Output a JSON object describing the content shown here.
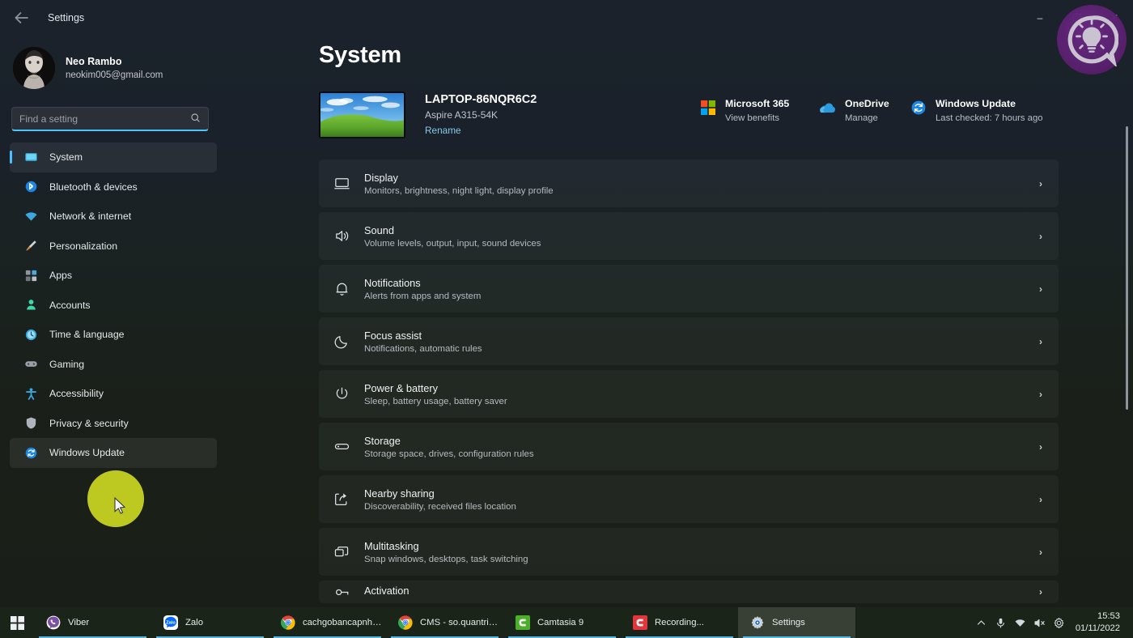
{
  "window": {
    "title": "Settings",
    "back_icon": "back-arrow-icon",
    "minimize": "–",
    "maximize": "❐",
    "close": "✕"
  },
  "profile": {
    "name": "Neo Rambo",
    "email": "neokim005@gmail.com"
  },
  "search": {
    "placeholder": "Find a setting",
    "value": "",
    "icon": "search-icon"
  },
  "sidebar": {
    "items": [
      {
        "label": "System",
        "icon": "monitor-icon",
        "active": true,
        "hovered": false
      },
      {
        "label": "Bluetooth & devices",
        "icon": "bluetooth-icon",
        "active": false,
        "hovered": false
      },
      {
        "label": "Network & internet",
        "icon": "wifi-icon",
        "active": false,
        "hovered": false
      },
      {
        "label": "Personalization",
        "icon": "paintbrush-icon",
        "active": false,
        "hovered": false
      },
      {
        "label": "Apps",
        "icon": "apps-grid-icon",
        "active": false,
        "hovered": false
      },
      {
        "label": "Accounts",
        "icon": "person-icon",
        "active": false,
        "hovered": false
      },
      {
        "label": "Time & language",
        "icon": "clock-globe-icon",
        "active": false,
        "hovered": false
      },
      {
        "label": "Gaming",
        "icon": "gamepad-icon",
        "active": false,
        "hovered": false
      },
      {
        "label": "Accessibility",
        "icon": "accessibility-person-icon",
        "active": false,
        "hovered": false
      },
      {
        "label": "Privacy & security",
        "icon": "shield-icon",
        "active": false,
        "hovered": false
      },
      {
        "label": "Windows Update",
        "icon": "update-refresh-icon",
        "active": false,
        "hovered": true
      }
    ]
  },
  "main": {
    "page_title": "System",
    "device": {
      "name": "LAPTOP-86NQR6C2",
      "model": "Aspire A315-54K",
      "rename_label": "Rename",
      "thumbnail": "bliss-wallpaper-thumbnail"
    },
    "status_tiles": [
      {
        "title": "Microsoft 365",
        "sub": "View benefits",
        "icon": "microsoft-logo-icon"
      },
      {
        "title": "OneDrive",
        "sub": "Manage",
        "icon": "onedrive-cloud-icon"
      },
      {
        "title": "Windows Update",
        "sub": "Last checked: 7 hours ago",
        "icon": "update-refresh-icon"
      }
    ],
    "settings_rows": [
      {
        "title": "Display",
        "sub": "Monitors, brightness, night light, display profile",
        "icon": "display-monitor-icon",
        "chevron": "›"
      },
      {
        "title": "Sound",
        "sub": "Volume levels, output, input, sound devices",
        "icon": "speaker-icon",
        "chevron": "›"
      },
      {
        "title": "Notifications",
        "sub": "Alerts from apps and system",
        "icon": "bell-icon",
        "chevron": "›"
      },
      {
        "title": "Focus assist",
        "sub": "Notifications, automatic rules",
        "icon": "moon-icon",
        "chevron": "›"
      },
      {
        "title": "Power & battery",
        "sub": "Sleep, battery usage, battery saver",
        "icon": "power-icon",
        "chevron": "›"
      },
      {
        "title": "Storage",
        "sub": "Storage space, drives, configuration rules",
        "icon": "storage-drive-icon",
        "chevron": "›"
      },
      {
        "title": "Nearby sharing",
        "sub": "Discoverability, received files location",
        "icon": "share-icon",
        "chevron": "›"
      },
      {
        "title": "Multitasking",
        "sub": "Snap windows, desktops, task switching",
        "icon": "windows-stack-icon",
        "chevron": "›"
      },
      {
        "title": "Activation",
        "sub": "",
        "icon": "activation-key-icon",
        "chevron": "›"
      }
    ]
  },
  "taskbar": {
    "start_icon": "windows-start-icon",
    "tasks": [
      {
        "label": "Viber",
        "icon": "viber-icon",
        "active": false
      },
      {
        "label": "Zalo",
        "icon": "zalo-icon",
        "active": false
      },
      {
        "label": "cachgobancapnhat ...",
        "icon": "chrome-icon",
        "active": false
      },
      {
        "label": "CMS - so.quantrima...",
        "icon": "chrome-icon",
        "active": false
      },
      {
        "label": "Camtasia 9",
        "icon": "camtasia-green-icon",
        "active": false
      },
      {
        "label": "Recording...",
        "icon": "camtasia-red-icon",
        "active": false
      },
      {
        "label": "Settings",
        "icon": "settings-gear-icon",
        "active": true
      }
    ],
    "tray": [
      {
        "icon": "chevron-up-icon"
      },
      {
        "icon": "microphone-icon"
      },
      {
        "icon": "wifi-icon"
      },
      {
        "icon": "speaker-muted-icon"
      },
      {
        "icon": "settings-gear-icon"
      }
    ],
    "clock": {
      "time": "15:53",
      "date": "01/11/2022"
    }
  },
  "overlay": {
    "watermark_icon": "lightbulb-chat-logo",
    "cursor_icon": "mouse-pointer-icon"
  },
  "colors": {
    "accent": "#4cc2ff",
    "highlight": "#d4e022",
    "taskbar_bg": "#1b2418",
    "link": "#84c9e8"
  }
}
